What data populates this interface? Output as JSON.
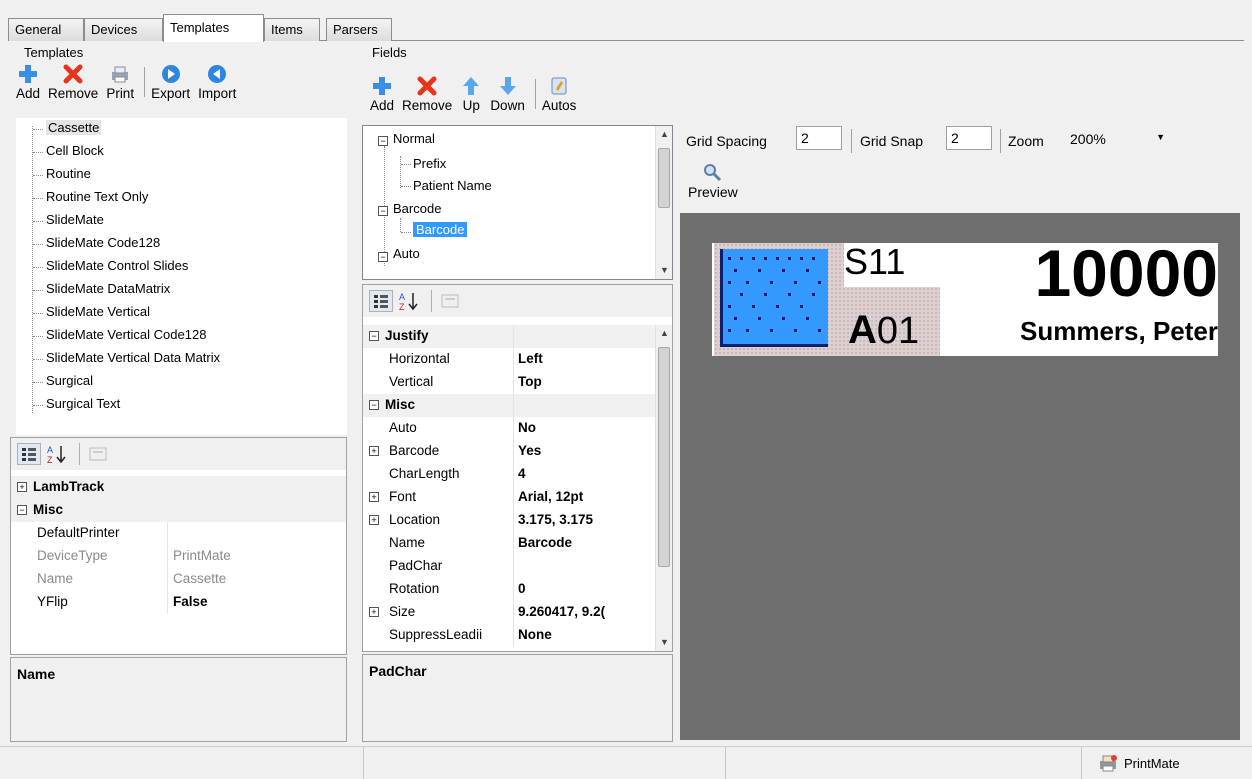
{
  "tabs": [
    "General",
    "Devices",
    "Templates",
    "Items",
    "Parsers"
  ],
  "active_tab": "Templates",
  "templates_panel": {
    "title": "Templates",
    "toolbar": {
      "add": "Add",
      "remove": "Remove",
      "print": "Print",
      "export": "Export",
      "import": "Import"
    },
    "list": [
      "Cassette",
      "Cell Block",
      "Routine",
      "Routine Text Only",
      "SlideMate",
      "SlideMate Code128",
      "SlideMate Control Slides",
      "SlideMate DataMatrix",
      "SlideMate Vertical",
      "SlideMate Vertical Code128",
      "SlideMate Vertical Data Matrix",
      "Surgical",
      "Surgical Text"
    ],
    "selected": "Cassette",
    "properties": {
      "cat_lambtrack": "LambTrack",
      "cat_misc": "Misc",
      "rows": [
        {
          "key": "DefaultPrinter",
          "value": "",
          "bold": false,
          "gray": false
        },
        {
          "key": "DeviceType",
          "value": "PrintMate",
          "bold": false,
          "gray": true
        },
        {
          "key": "Name",
          "value": "Cassette",
          "bold": false,
          "gray": true
        },
        {
          "key": "YFlip",
          "value": "False",
          "bold": true,
          "gray": false
        }
      ]
    },
    "description_title": "Name"
  },
  "fields_panel": {
    "title": "Fields",
    "toolbar": {
      "add": "Add",
      "remove": "Remove",
      "up": "Up",
      "down": "Down",
      "autos": "Autos"
    },
    "tree": {
      "normal": "Normal",
      "prefix": "Prefix",
      "patient_name": "Patient Name",
      "barcode_group": "Barcode",
      "barcode_item": "Barcode",
      "auto": "Auto"
    },
    "properties": {
      "cat_justify": "Justify",
      "horizontal_k": "Horizontal",
      "horizontal_v": "Left",
      "vertical_k": "Vertical",
      "vertical_v": "Top",
      "cat_misc": "Misc",
      "auto_k": "Auto",
      "auto_v": "No",
      "barcode_k": "Barcode",
      "barcode_v": "Yes",
      "charlength_k": "CharLength",
      "charlength_v": "4",
      "font_k": "Font",
      "font_v": "Arial, 12pt",
      "location_k": "Location",
      "location_v": "3.175, 3.175",
      "name_k": "Name",
      "name_v": "Barcode",
      "padchar_k": "PadChar",
      "padchar_v": "",
      "rotation_k": "Rotation",
      "rotation_v": "0",
      "size_k": "Size",
      "size_v": "9.260417, 9.2(",
      "suppress_k": "SuppressLeadii",
      "suppress_v": "None"
    },
    "description_title": "PadChar"
  },
  "designer": {
    "grid_spacing_label": "Grid Spacing",
    "grid_spacing_value": "2",
    "grid_snap_label": "Grid Snap",
    "grid_snap_value": "2",
    "zoom_label": "Zoom",
    "zoom_value": "200%",
    "preview_label": "Preview",
    "label_text": {
      "s11": "S11",
      "number": "10000",
      "a01": "A01",
      "name": "Summers, Peter"
    }
  },
  "status": {
    "printer": "PrintMate"
  },
  "colors": {
    "accent_blue": "#3399ff",
    "canvas_gray": "#6e6e6e",
    "remove_red": "#e8341c"
  }
}
